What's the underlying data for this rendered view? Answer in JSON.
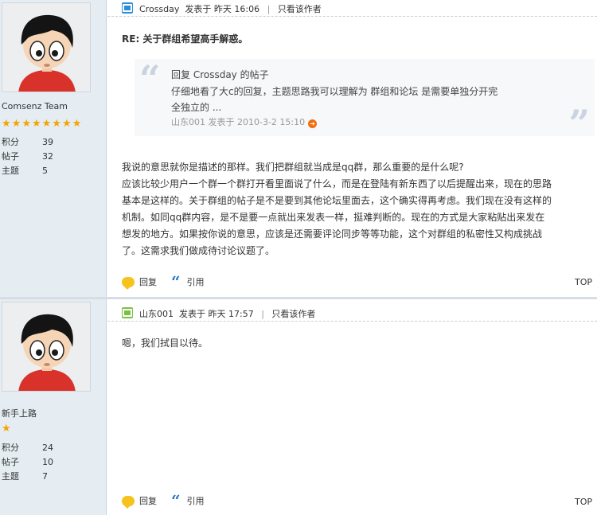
{
  "posts": [
    {
      "author": "Crossday",
      "posted": "发表于 昨天 16:06",
      "only_author": "只看该作者",
      "user_group": "Comsenz Team",
      "stars": 8,
      "stats": [
        {
          "label": "积分",
          "value": "39"
        },
        {
          "label": "帖子",
          "value": "32"
        },
        {
          "label": "主题",
          "value": "5"
        }
      ],
      "title": "RE: 关于群组希望高手解惑。",
      "quote": {
        "header": "回复  Crossday 的帖子",
        "lines": [
          "仔细地看了大c的回复，主题思路我可以理解为 群组和论坛 是需要单独分开完",
          "全独立的 ..."
        ],
        "meta": "山东001 发表于 2010-3-2 15:10"
      },
      "body_lines": [
        "我说的意思就你是描述的那样。我们把群组就当成是qq群，那么重要的是什么呢?",
        "应该比较少用户一个群一个群打开看里面说了什么，而是在登陆有新东西了以后提醒出来，现在的思路",
        "基本是这样的。关于群组的帖子是不是要到其他论坛里面去，这个确实得再考虑。我们现在没有这样的",
        "机制。如同qq群内容，是不是要一点就出来发表一样，挺难判断的。现在的方式是大家粘贴出来发在",
        "想发的地方。如果按你说的意思，应该是还需要评论同步等等功能，这个对群组的私密性又构成挑战",
        "了。这需求我们做成待讨论议题了。"
      ],
      "reply_label": "回复",
      "quote_label": "引用",
      "top_label": "TOP"
    },
    {
      "author": "山东001",
      "posted": "发表于 昨天 17:57",
      "only_author": "只看该作者",
      "user_group": "新手上路",
      "stars": 1,
      "stats": [
        {
          "label": "积分",
          "value": "24"
        },
        {
          "label": "帖子",
          "value": "10"
        },
        {
          "label": "主题",
          "value": "7"
        }
      ],
      "body_lines": [
        "嗯，我们拭目以待。"
      ],
      "reply_label": "回复",
      "quote_label": "引用",
      "top_label": "TOP"
    }
  ],
  "colors": {
    "sidebar": "#e5edf2",
    "author_icon_1": "#2b8fd8",
    "author_icon_2": "#7ac143",
    "accent_link": "#2b7bc9"
  }
}
